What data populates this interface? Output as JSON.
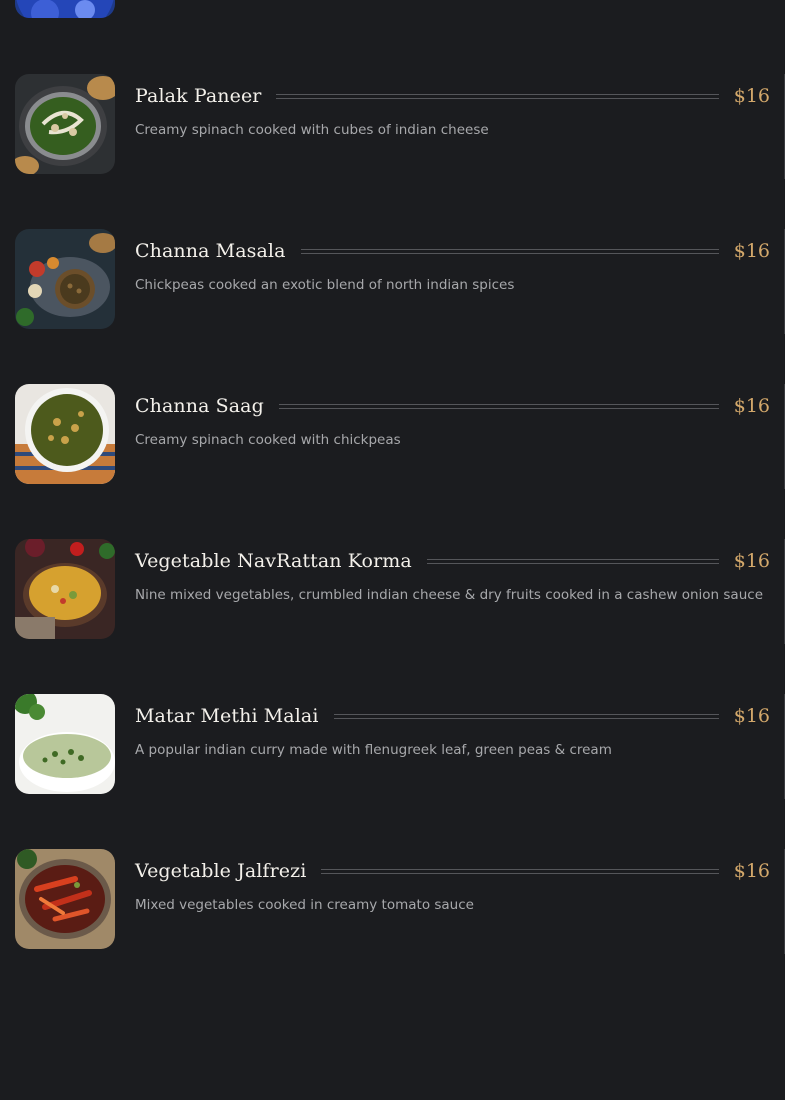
{
  "menu": {
    "items": [
      {
        "name": "Palak Paneer",
        "price": "$16",
        "description": "Creamy spinach cooked with cubes of indian cheese",
        "image_icon": "palak-paneer-photo"
      },
      {
        "name": "Channa Masala",
        "price": "$16",
        "description": "Chickpeas cooked an exotic blend of north indian spices",
        "image_icon": "channa-masala-photo"
      },
      {
        "name": "Channa Saag",
        "price": "$16",
        "description": "Creamy spinach cooked with chickpeas",
        "image_icon": "channa-saag-photo"
      },
      {
        "name": "Vegetable NavRattan Korma",
        "price": "$16",
        "description": "Nine mixed vegetables, crumbled indian cheese & dry fruits cooked in a cashew onion sauce",
        "image_icon": "navrattan-korma-photo"
      },
      {
        "name": "Matar Methi Malai",
        "price": "$16",
        "description": "A popular indian curry made with flenugreek leaf, green peas & cream",
        "image_icon": "matar-methi-malai-photo"
      },
      {
        "name": "Vegetable Jalfrezi",
        "price": "$16",
        "description": "Mixed vegetables cooked in creamy tomato sauce",
        "image_icon": "vegetable-jalfrezi-photo"
      }
    ]
  },
  "colors": {
    "background": "#1b1c1f",
    "item_name": "#f3f0ea",
    "price_accent": "#d3a86b",
    "description": "#a7a8ab",
    "dotted_rule": "#55565a"
  }
}
